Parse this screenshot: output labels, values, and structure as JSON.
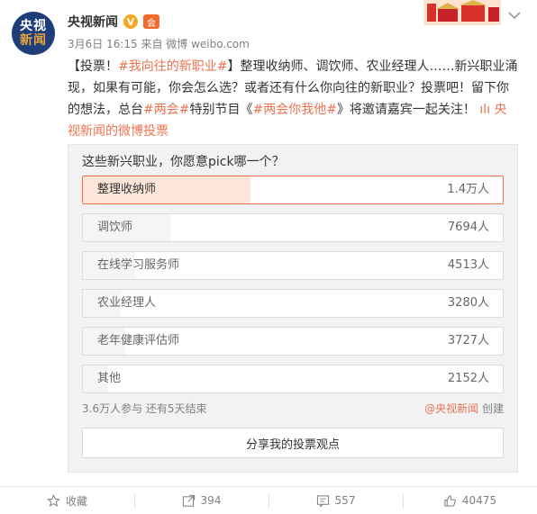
{
  "post": {
    "account_name": "央视新闻",
    "avatar_line1": "央视",
    "avatar_line2": "新闻",
    "verified_mark": "V",
    "member_mark": "会",
    "meta": "3月6日 16:15 来自 微博 weibo.com",
    "text": {
      "p1": "【投票！",
      "tag1": "#我向往的新职业#",
      "p2": "】整理收纳师、调饮师、农业经理人……新兴职业涌现，如果有可能，你会怎么选？或者还有什么你向往的新职业？投票吧！留下你的想法，总台",
      "tag2": "#两会#",
      "p3": "特别节目《",
      "tag3": "#两会你我他#",
      "p4": "》将邀请嘉宾一起关注！ ",
      "link_icon": "ılı",
      "link_text": "央视新闻的微博投票"
    }
  },
  "poll": {
    "question": "这些新兴职业，你愿意pick哪一个？",
    "options": [
      {
        "label": "整理收纳师",
        "value": "1.4万人",
        "share": 0.4,
        "selected": true
      },
      {
        "label": "调饮师",
        "value": "7694人",
        "share": 0.21
      },
      {
        "label": "在线学习服务师",
        "value": "4513人",
        "share": 0.125
      },
      {
        "label": "农业经理人",
        "value": "3280人",
        "share": 0.09
      },
      {
        "label": "老年健康评估师",
        "value": "3727人",
        "share": 0.1
      },
      {
        "label": "其他",
        "value": "2152人",
        "share": 0.06
      }
    ],
    "footer": "3.6万人参与 还有5天结束",
    "creator_handle": "@央视新闻",
    "creator_suffix": " 创建",
    "share_button": "分享我的投票观点"
  },
  "actions": {
    "favorite_label": "收藏",
    "repost_count": "394",
    "comment_count": "557",
    "like_count": "40475"
  },
  "colors": {
    "link": "#eb7350",
    "selected_fill": "#fde5da",
    "avatar_bg": "#1e3e7a"
  }
}
